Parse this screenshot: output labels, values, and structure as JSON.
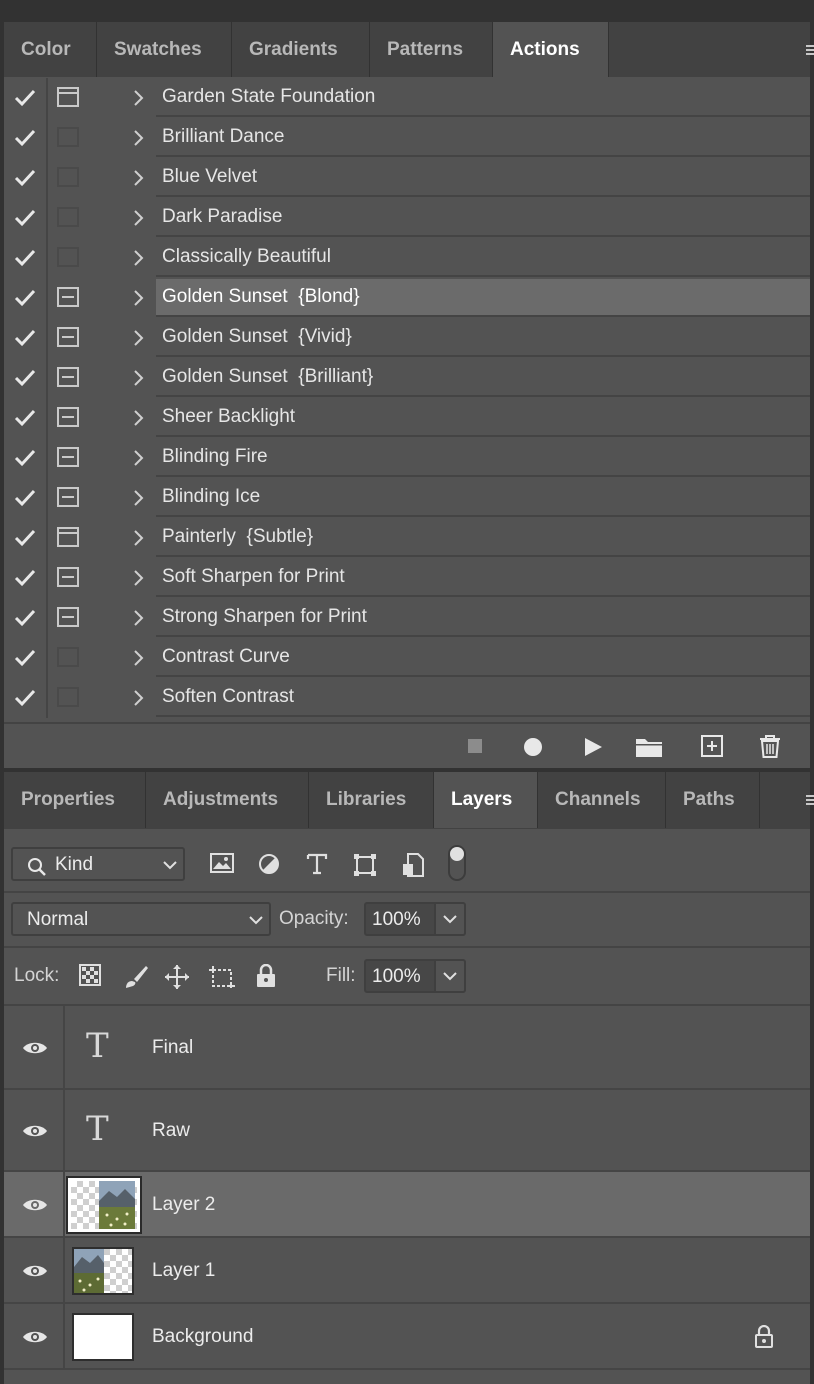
{
  "actions_panel": {
    "tabs": [
      {
        "label": "Color",
        "active": false
      },
      {
        "label": "Swatches",
        "active": false
      },
      {
        "label": "Gradients",
        "active": false
      },
      {
        "label": "Patterns",
        "active": false
      },
      {
        "label": "Actions",
        "active": true
      }
    ],
    "items": [
      {
        "label": "Garden State Foundation",
        "dialog": "full",
        "selected": false
      },
      {
        "label": "Brilliant Dance",
        "dialog": "none",
        "selected": false
      },
      {
        "label": "Blue Velvet",
        "dialog": "none",
        "selected": false
      },
      {
        "label": "Dark Paradise",
        "dialog": "none",
        "selected": false
      },
      {
        "label": "Classically Beautiful",
        "dialog": "none",
        "selected": false
      },
      {
        "label": "Golden Sunset  {Blond}",
        "dialog": "partial",
        "selected": true
      },
      {
        "label": "Golden Sunset  {Vivid}",
        "dialog": "partial",
        "selected": false
      },
      {
        "label": "Golden Sunset  {Brilliant}",
        "dialog": "partial",
        "selected": false
      },
      {
        "label": "Sheer Backlight",
        "dialog": "partial",
        "selected": false
      },
      {
        "label": "Blinding Fire",
        "dialog": "partial",
        "selected": false
      },
      {
        "label": "Blinding Ice",
        "dialog": "partial",
        "selected": false
      },
      {
        "label": "Painterly  {Subtle}",
        "dialog": "full",
        "selected": false
      },
      {
        "label": "Soft Sharpen for Print",
        "dialog": "partial",
        "selected": false
      },
      {
        "label": "Strong Sharpen for Print",
        "dialog": "partial",
        "selected": false
      },
      {
        "label": "Contrast Curve",
        "dialog": "none",
        "selected": false
      },
      {
        "label": "Soften Contrast",
        "dialog": "none",
        "selected": false
      }
    ],
    "footer_icons": [
      "stop-icon",
      "record-icon",
      "play-icon",
      "folder-icon",
      "new-action-icon",
      "trash-icon"
    ]
  },
  "layers_panel": {
    "tabs": [
      {
        "label": "Properties",
        "active": false
      },
      {
        "label": "Adjustments",
        "active": false
      },
      {
        "label": "Libraries",
        "active": false
      },
      {
        "label": "Layers",
        "active": true
      },
      {
        "label": "Channels",
        "active": false
      },
      {
        "label": "Paths",
        "active": false
      }
    ],
    "filter": {
      "kind_label": "Kind",
      "filter_icons": [
        "image-filter-icon",
        "adjustment-filter-icon",
        "type-filter-icon",
        "shape-filter-icon",
        "smart-object-filter-icon"
      ]
    },
    "blend_mode": "Normal",
    "opacity_label": "Opacity:",
    "opacity_value": "100%",
    "lock_label": "Lock:",
    "fill_label": "Fill:",
    "fill_value": "100%",
    "layers": [
      {
        "name": "Final",
        "type": "text",
        "visible": true,
        "selected": false,
        "locked": false
      },
      {
        "name": "Raw",
        "type": "text",
        "visible": true,
        "selected": false,
        "locked": false
      },
      {
        "name": "Layer 2",
        "type": "image",
        "visible": true,
        "selected": true,
        "locked": false
      },
      {
        "name": "Layer 1",
        "type": "image",
        "visible": true,
        "selected": false,
        "locked": false
      },
      {
        "name": "Background",
        "type": "fill",
        "visible": true,
        "selected": false,
        "locked": true
      }
    ]
  }
}
